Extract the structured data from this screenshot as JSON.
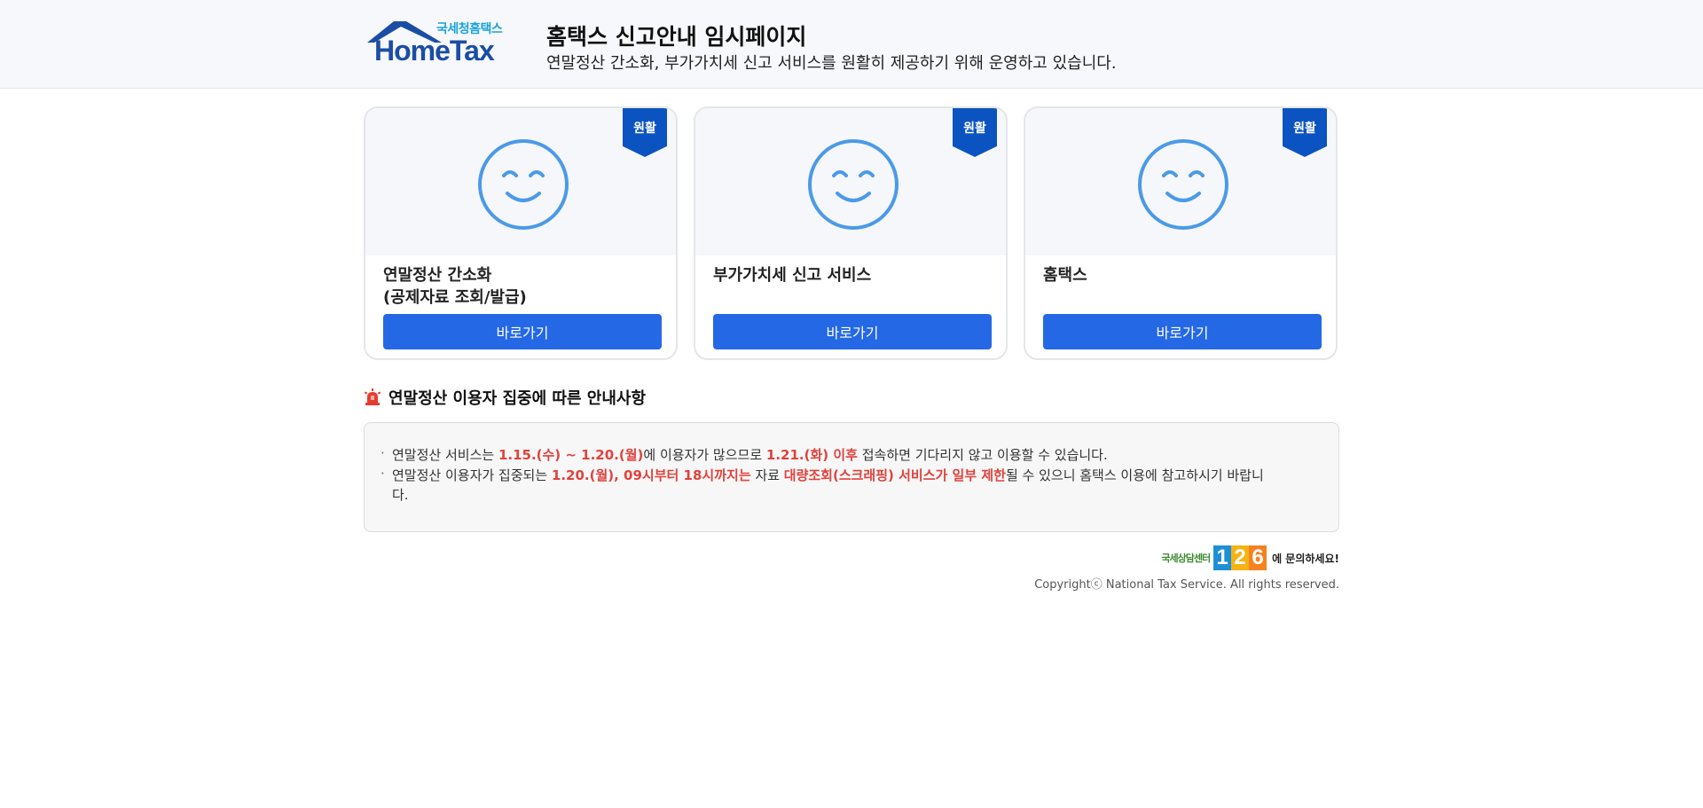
{
  "header": {
    "logo_sub": "국세청홈택스",
    "logo_main": "HomeTax",
    "title": "홈택스 신고안내 임시페이지",
    "subtitle": "연말정산 간소화, 부가가치세 신고 서비스를 원활히 제공하기 위해 운영하고 있습니다."
  },
  "cards": [
    {
      "status": "원활",
      "title_line1": "연말정산 간소화",
      "title_line2": "(공제자료 조회/발급)",
      "button": "바로가기"
    },
    {
      "status": "원활",
      "title_line1": "부가가치세 신고 서비스",
      "title_line2": "",
      "button": "바로가기"
    },
    {
      "status": "원활",
      "title_line1": "홈택스",
      "title_line2": "",
      "button": "바로가기"
    }
  ],
  "notice": {
    "title": "연말정산 이용자 집중에 따른 안내사항",
    "item1": {
      "t1": "연말정산 서비스는 ",
      "h1": "1.15.(수) ~ 1.20.(월)",
      "t2": "에 이용자가 많으므로 ",
      "h2": "1.21.(화) 이후",
      "t3": " 접속하면 기다리지 않고 이용할 수 있습니다."
    },
    "item2": {
      "t1": "연말정산 이용자가 집중되는 ",
      "h1": "1.20.(월), 09시부터 18시까지는",
      "t2": " 자료 ",
      "h2": "대량조회(스크래핑) 서비스가 일부 제한",
      "t3": "될 수 있으니 홈택스 이용에 참고하시기 바랍니다."
    }
  },
  "footer": {
    "call_center_label": "국세상담센터",
    "digit1": "1",
    "digit2": "2",
    "digit3": "6",
    "call_center_ask": "에 문의하세요!",
    "copyright": "Copyrightⓒ National Tax Service. All rights reserved."
  },
  "colors": {
    "brand_blue": "#1b4ea3",
    "button_blue": "#2468e5",
    "ribbon_blue": "#0b53c1",
    "smile_blue": "#4b9ae8",
    "highlight_red": "#e0423d"
  },
  "icons": {
    "status_face": "smile-icon",
    "notice": "siren-icon"
  }
}
